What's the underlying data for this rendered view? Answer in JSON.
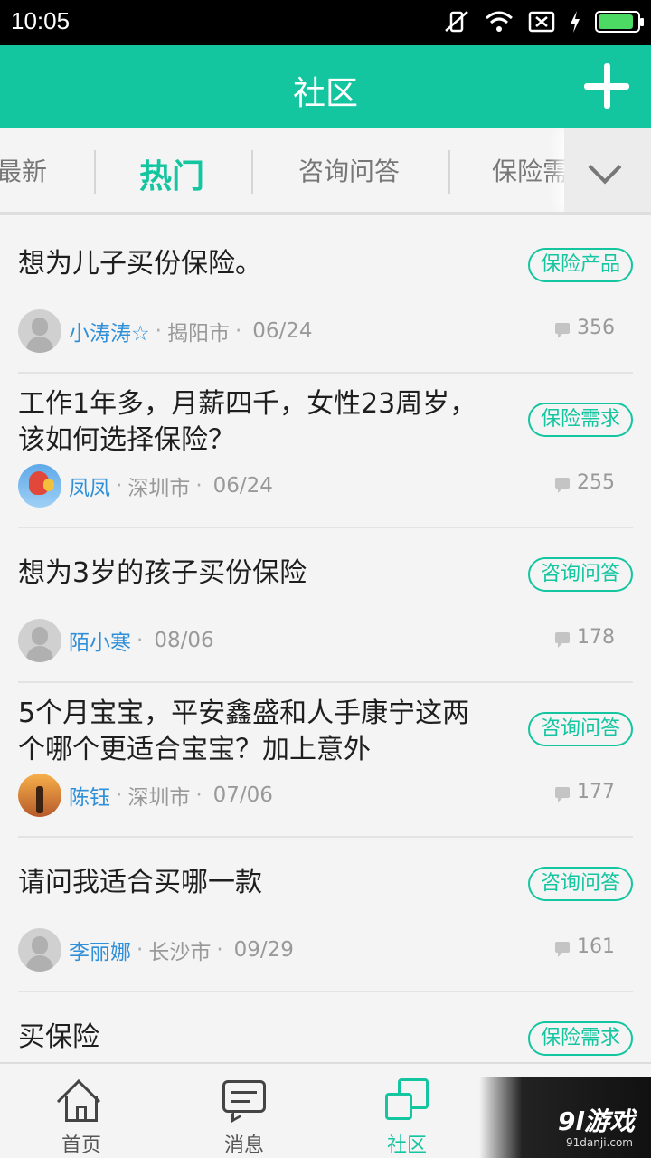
{
  "status_bar": {
    "time": "10:05",
    "battery_level": 0.9
  },
  "app_bar": {
    "title": "社区"
  },
  "tabs": [
    {
      "label": "最新"
    },
    {
      "label": "热门",
      "active": true
    },
    {
      "label": "咨询问答"
    },
    {
      "label": "保险需"
    }
  ],
  "posts": [
    {
      "title": "想为儿子买份保险。",
      "tag": "保险产品",
      "author": "小涛涛☆",
      "city": "揭阳市",
      "date": "06/24",
      "comments": "356",
      "avatar": "default"
    },
    {
      "title": "工作1年多，月薪四千，女性23周岁，该如何选择保险？",
      "tag": "保险需求",
      "author": "凤凤",
      "city": "深圳市",
      "date": "06/24",
      "comments": "255",
      "avatar": "balloon"
    },
    {
      "title": "想为3岁的孩子买份保险",
      "tag": "咨询问答",
      "author": "陌小寒",
      "city": "",
      "date": "08/06",
      "comments": "178",
      "avatar": "default"
    },
    {
      "title": "5个月宝宝，平安鑫盛和人手康宁这两个哪个更适合宝宝？加上意外",
      "tag": "咨询问答",
      "author": "陈钰",
      "city": "深圳市",
      "date": "07/06",
      "comments": "177",
      "avatar": "sunset"
    },
    {
      "title": "请问我适合买哪一款",
      "tag": "咨询问答",
      "author": "李丽娜",
      "city": "长沙市",
      "date": "09/29",
      "comments": "161",
      "avatar": "default"
    },
    {
      "title": "买保险",
      "tag": "保险需求",
      "author": "",
      "city": "",
      "date": "",
      "comments": "",
      "avatar": "none"
    }
  ],
  "bottom_nav": [
    {
      "label": "首页",
      "icon": "home-icon"
    },
    {
      "label": "消息",
      "icon": "message-icon"
    },
    {
      "label": "社区",
      "icon": "community-icon",
      "active": true
    },
    {
      "label": "",
      "icon": "location-icon"
    }
  ],
  "watermark": {
    "brand": "9l游戏",
    "site": "91danji.com"
  },
  "colors": {
    "accent": "#14c6a0",
    "link": "#2f8fd8"
  }
}
